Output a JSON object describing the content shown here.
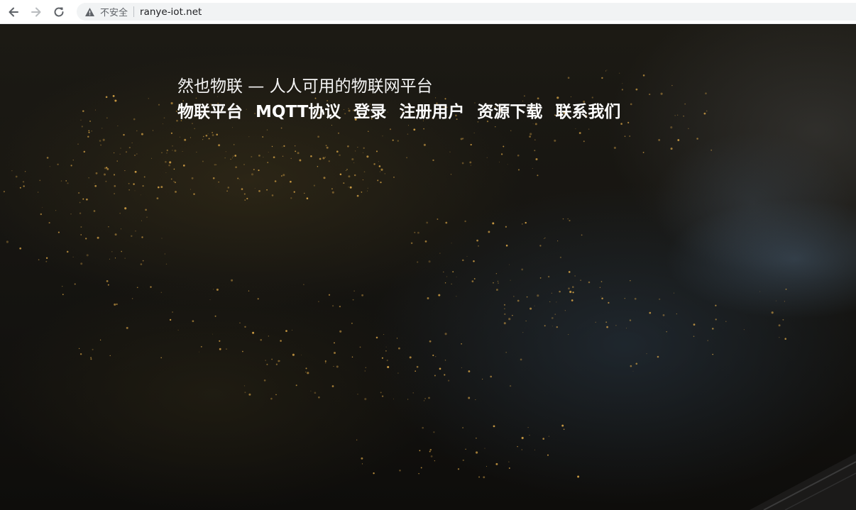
{
  "browser": {
    "back_icon": "arrow-left-icon",
    "forward_icon": "arrow-right-icon",
    "reload_icon": "reload-icon",
    "security_icon": "warning-triangle-icon",
    "security_label": "不安全",
    "url": "ranye-iot.net"
  },
  "hero": {
    "headline": "然也物联 — 人人可用的物联网平台"
  },
  "nav": {
    "items": [
      {
        "label": "物联平台"
      },
      {
        "label": "MQTT协议"
      },
      {
        "label": "登录"
      },
      {
        "label": "注册用户"
      },
      {
        "label": "资源下载"
      },
      {
        "label": "联系我们"
      }
    ]
  },
  "colors": {
    "nav_text": "#ffffff",
    "headline_text": "#f4f4f4",
    "city_lights": "#e8b04a"
  }
}
